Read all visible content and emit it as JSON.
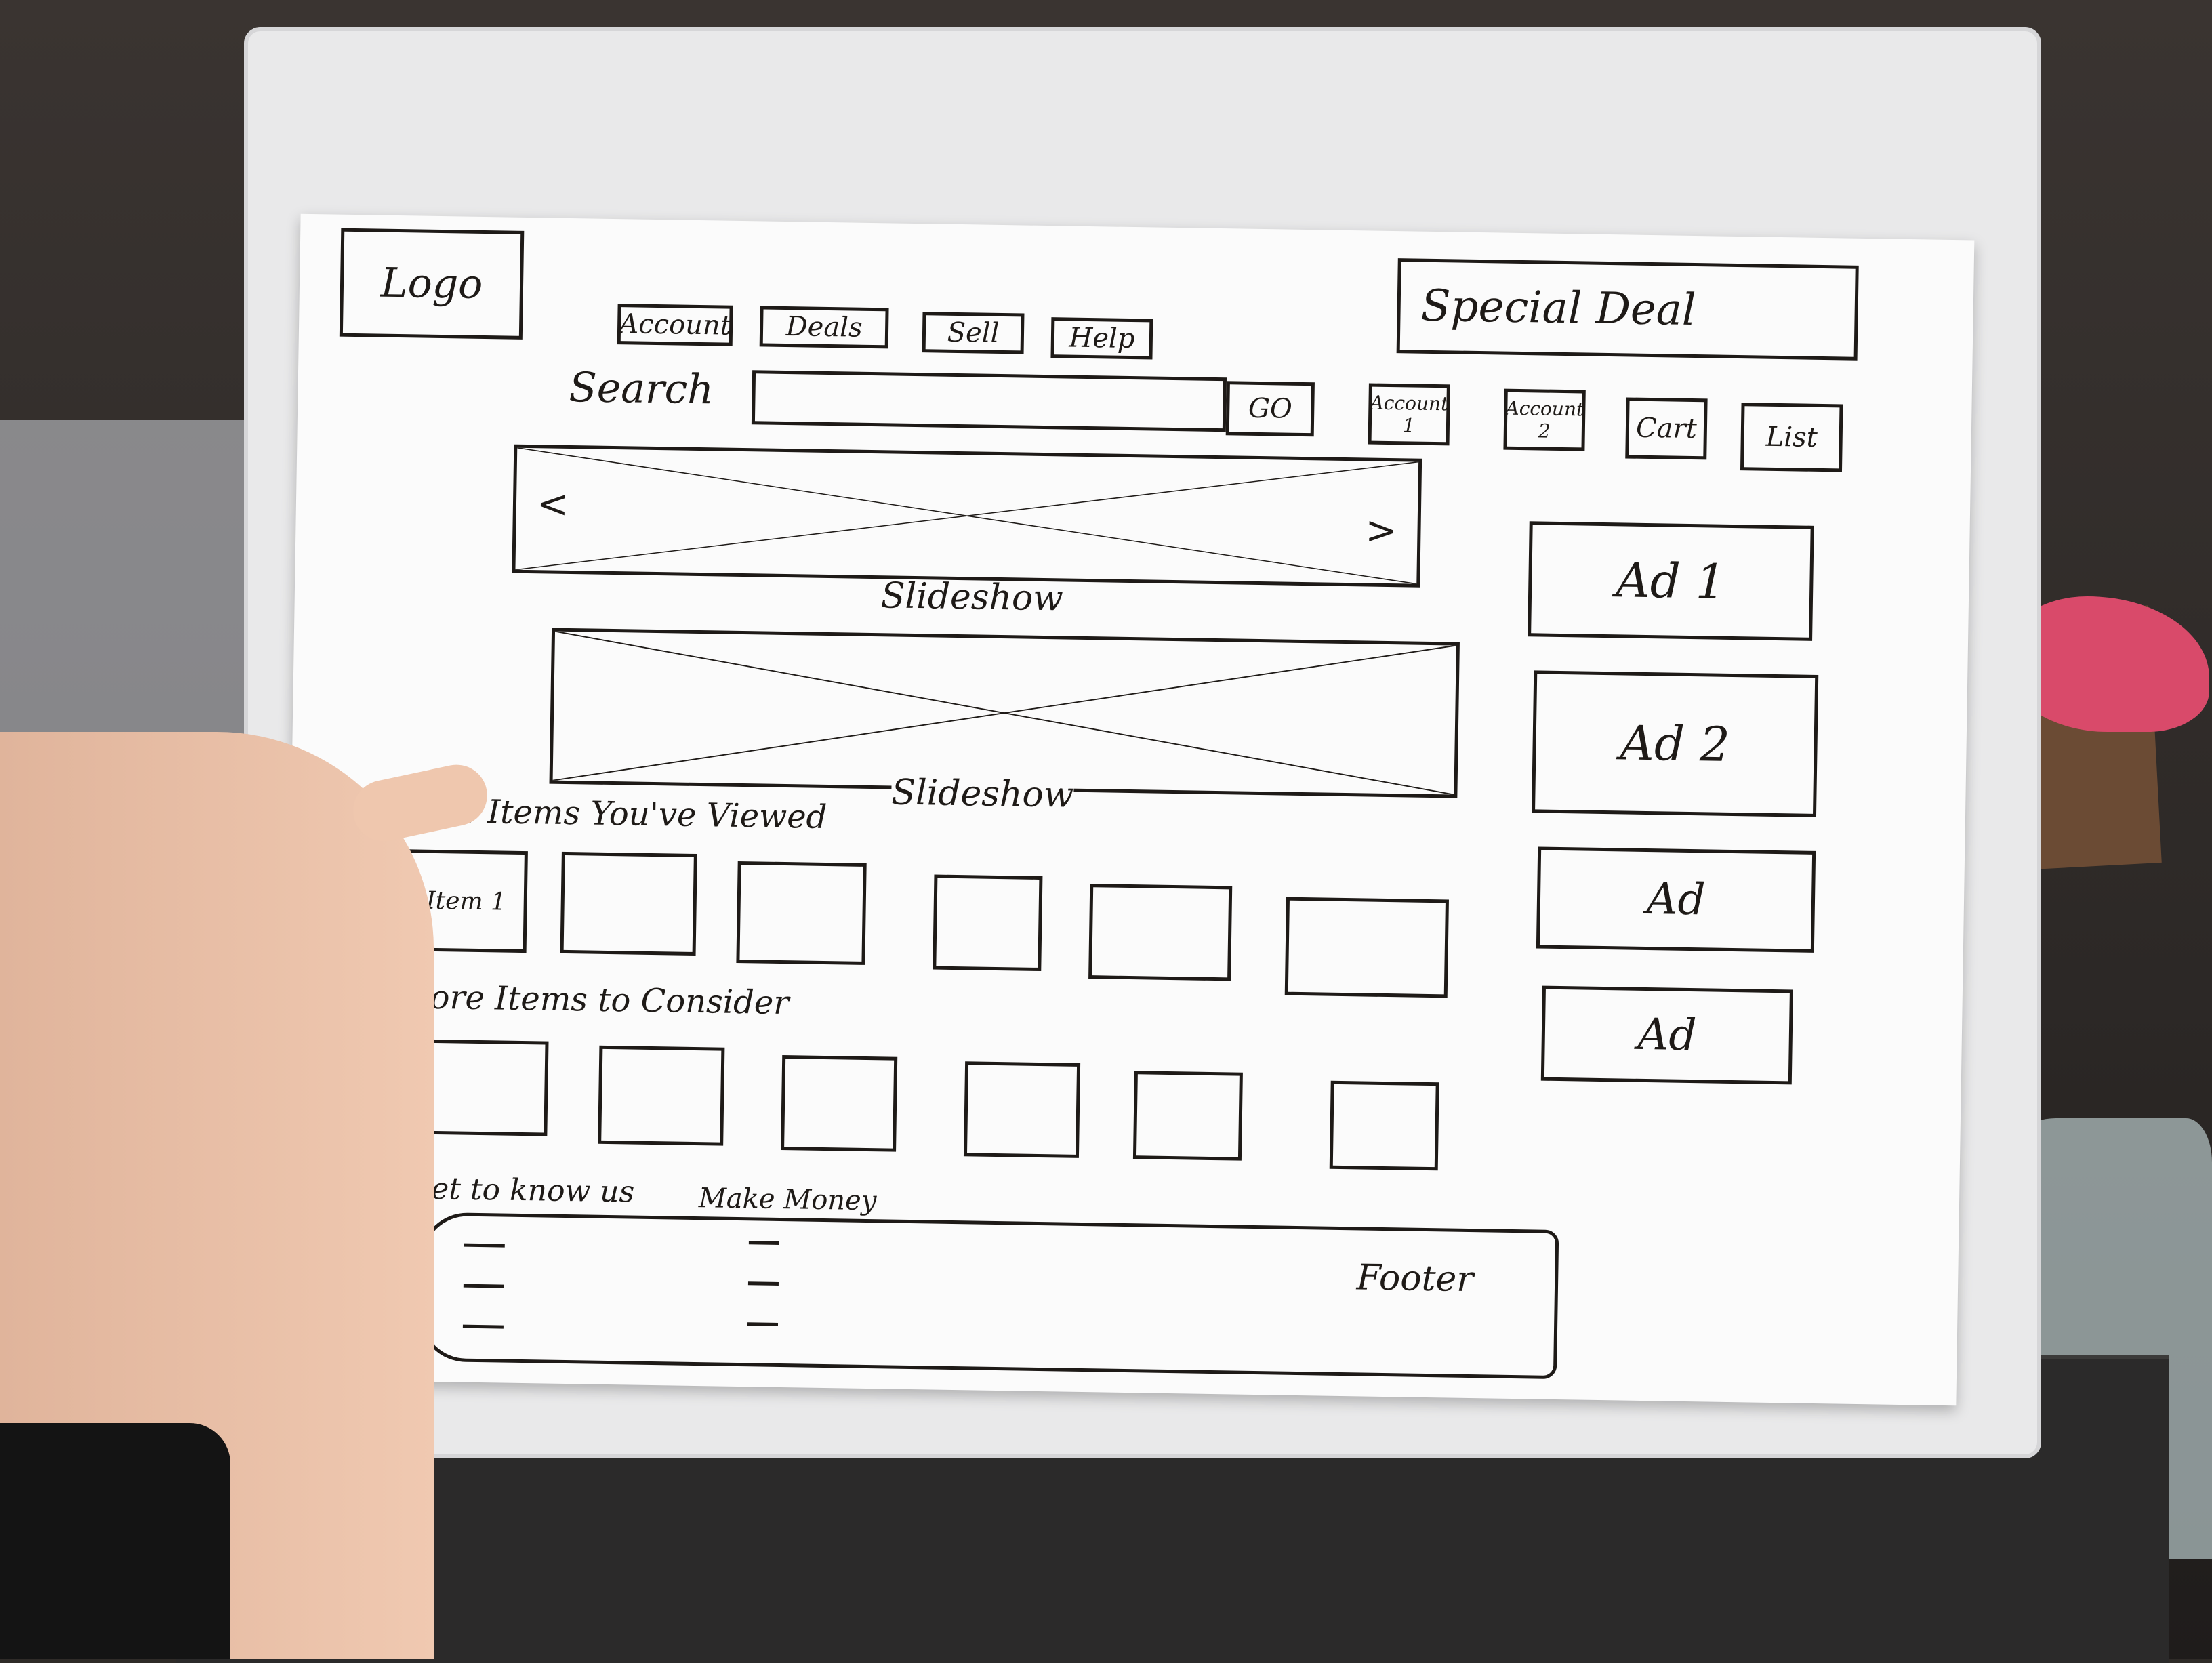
{
  "header": {
    "logo": "Logo",
    "nav": [
      "Account",
      "Deals",
      "Sell",
      "Help"
    ],
    "special_deal": "Special Deal"
  },
  "search": {
    "label": "Search",
    "go": "GO"
  },
  "user_links": [
    "Account 1",
    "Account 2",
    "Cart",
    "List"
  ],
  "slideshows": [
    "Slideshow",
    "Slideshow"
  ],
  "slideshow_prev": "<",
  "slideshow_next": ">",
  "ads": [
    "Ad 1",
    "Ad 2",
    "Ad",
    "Ad"
  ],
  "recently_viewed": {
    "title": "...ted Items You've Viewed",
    "first_item": "Item 1"
  },
  "more_items": {
    "title": "More Items to Consider"
  },
  "footer": {
    "label": "Footer",
    "col1": "Get to know us",
    "col2": "Make Money"
  }
}
